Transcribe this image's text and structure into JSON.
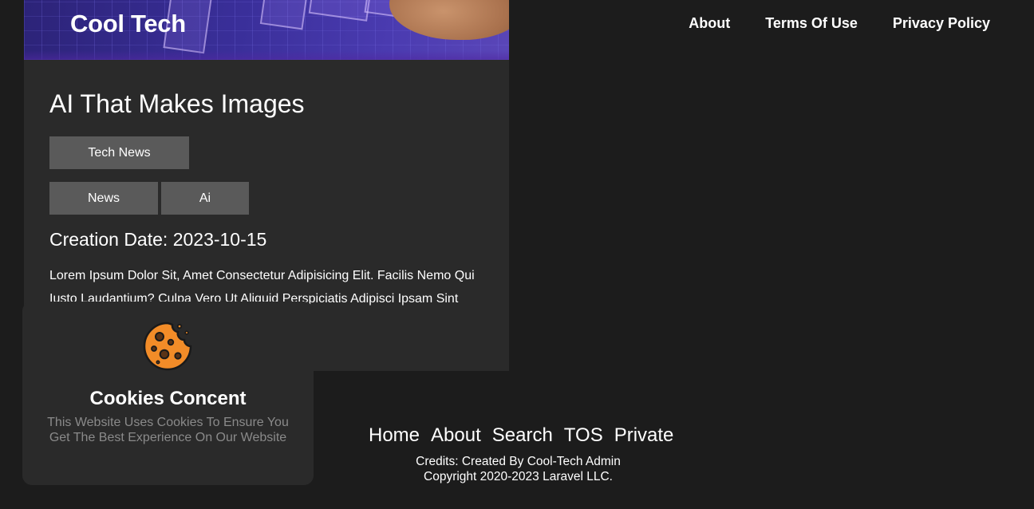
{
  "header": {
    "brand": "Cool Tech",
    "nav": [
      "About",
      "Terms Of Use",
      "Privacy Policy"
    ]
  },
  "article": {
    "title": "AI That Makes Images",
    "category": "Tech News",
    "tags": [
      "News",
      "Ai"
    ],
    "creation_date": "Creation Date: 2023-10-15",
    "excerpt": "Lorem Ipsum Dolor Sit, Amet Consectetur Adipisicing Elit. Facilis Nemo Qui Iusto Laudantium? Culpa Vero Ut Aliquid Perspiciatis Adipisci Ipsam Sint Dolore Quibusdam Nemo Sapiente Por..."
  },
  "cookie_popup": {
    "icon": "cookie-icon",
    "title": "Cookies Concent",
    "text": "This Website Uses Cookies To Ensure You Get The Best Experience On Our Website"
  },
  "footer": {
    "links": [
      "Home",
      "About",
      "Search",
      "TOS",
      "Private"
    ],
    "credits": "Credits: Created By Cool-Tech Admin",
    "copyright": "Copyright 2020-2023 Laravel LLC."
  },
  "colors": {
    "background": "#1c1c1c",
    "card": "#2a2a2a",
    "tag": "#5a5a5a",
    "cookie_orange": "#f28c28"
  }
}
